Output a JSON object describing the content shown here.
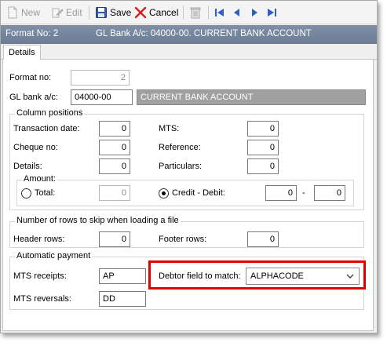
{
  "toolbar": {
    "new_label": "New",
    "edit_label": "Edit",
    "save_label": "Save",
    "cancel_label": "Cancel"
  },
  "header": {
    "format_no_text": "Format No:  2",
    "gl_bank_text": "GL Bank A/c:  04000-00. CURRENT BANK ACCOUNT"
  },
  "tabs": {
    "details_label": "Details"
  },
  "form": {
    "format_no_label": "Format no:",
    "format_no_value": "2",
    "gl_bank_label": "GL bank a/c:",
    "gl_bank_code": "04000-00",
    "gl_bank_name": "CURRENT BANK ACCOUNT"
  },
  "column_positions": {
    "title": "Column positions",
    "transaction_date_label": "Transaction date:",
    "transaction_date_value": "0",
    "cheque_no_label": "Cheque no:",
    "cheque_no_value": "0",
    "details_label": "Details:",
    "details_value": "0",
    "mts_label": "MTS:",
    "mts_value": "0",
    "reference_label": "Reference:",
    "reference_value": "0",
    "particulars_label": "Particulars:",
    "particulars_value": "0",
    "amount": {
      "title": "Amount:",
      "total_label": "Total:",
      "total_value": "0",
      "credit_debit_label": "Credit - Debit:",
      "credit_value": "0",
      "dash": "-",
      "debit_value": "0",
      "selected": "credit_debit"
    }
  },
  "skip_rows": {
    "title": "Number of rows to skip when loading a file",
    "header_rows_label": "Header rows:",
    "header_rows_value": "0",
    "footer_rows_label": "Footer rows:",
    "footer_rows_value": "0"
  },
  "auto_payment": {
    "title": "Automatic payment",
    "mts_receipts_label": "MTS receipts:",
    "mts_receipts_value": "AP",
    "mts_reversals_label": "MTS reversals:",
    "mts_reversals_value": "DD",
    "debtor_field_label": "Debtor field to match:",
    "debtor_field_value": "ALPHACODE"
  },
  "colors": {
    "header_bar": "#7486a0",
    "highlight": "#e00000",
    "readonly_field": "#a0a0a0",
    "nav_arrows": "#2f5fbf"
  }
}
